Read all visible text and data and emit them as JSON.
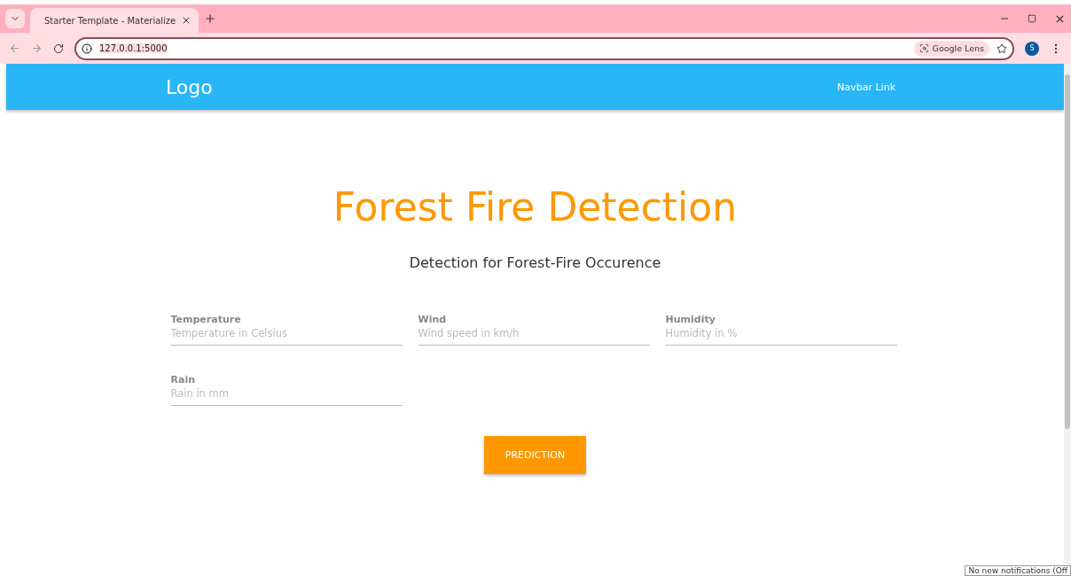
{
  "browser": {
    "tab": {
      "title": "Starter Template - Materialize",
      "selected": true
    },
    "address": "127.0.0.1:5000",
    "lens_label": "Google Lens",
    "profile_initial": "S"
  },
  "navbar": {
    "logo": "Logo",
    "links": [
      "Navbar Link"
    ]
  },
  "page": {
    "title": "Forest Fire Detection",
    "subtitle": "Detection for Forest-Fire Occurence",
    "fields": [
      {
        "label": "Temperature",
        "placeholder": "Temperature in Celsius"
      },
      {
        "label": "Wind",
        "placeholder": "Wind speed in km/h"
      },
      {
        "label": "Humidity",
        "placeholder": "Humidity in %"
      },
      {
        "label": "Rain",
        "placeholder": "Rain in mm"
      }
    ],
    "button": "PREDICTION"
  },
  "tooltip": "No new notifications (Off"
}
